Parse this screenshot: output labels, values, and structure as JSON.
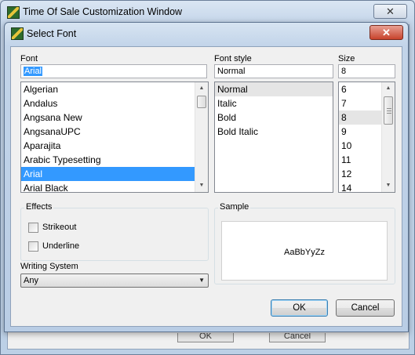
{
  "outer_window": {
    "title": "Time Of Sale Customization Window",
    "close_glyph": "✕",
    "ghost_buttons": [
      "OK",
      "Cancel"
    ]
  },
  "dialog": {
    "title": "Select Font",
    "close_glyph": "✕",
    "font": {
      "label": "Font",
      "value": "Arial",
      "items": [
        "Algerian",
        "Andalus",
        "Angsana New",
        "AngsanaUPC",
        "Aparajita",
        "Arabic Typesetting",
        "Arial",
        "Arial Black"
      ],
      "selected": "Arial"
    },
    "font_style": {
      "label": "Font style",
      "value": "Normal",
      "items": [
        "Normal",
        "Italic",
        "Bold",
        "Bold Italic"
      ],
      "selected": "Normal"
    },
    "size": {
      "label": "Size",
      "value": "8",
      "items": [
        "6",
        "7",
        "8",
        "9",
        "10",
        "11",
        "12",
        "14"
      ],
      "selected": "8"
    },
    "effects": {
      "label": "Effects",
      "strikeout_label": "Strikeout",
      "strikeout_checked": false,
      "underline_label": "Underline",
      "underline_checked": false
    },
    "sample": {
      "label": "Sample",
      "text": "AaBbYyZz"
    },
    "writing_system": {
      "label": "Writing System",
      "value": "Any"
    },
    "buttons": {
      "ok": "OK",
      "cancel": "Cancel"
    }
  },
  "icons": {
    "app": "app-icon",
    "dialog": "app-icon",
    "scroll_up": "▲",
    "scroll_down": "▼",
    "combo": "▼"
  }
}
